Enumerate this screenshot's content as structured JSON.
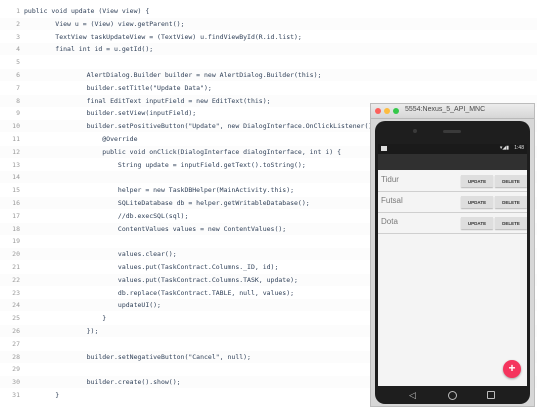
{
  "code_lines": [
    {
      "n": "1",
      "t": "public void update (View view) {"
    },
    {
      "n": "2",
      "t": "        View u = (View) view.getParent();"
    },
    {
      "n": "3",
      "t": "        TextView taskUpdateView = (TextView) u.findViewById(R.id.list);"
    },
    {
      "n": "4",
      "t": "        final int id = u.getId();"
    },
    {
      "n": "5",
      "t": ""
    },
    {
      "n": "6",
      "t": "                AlertDialog.Builder builder = new AlertDialog.Builder(this);"
    },
    {
      "n": "7",
      "t": "                builder.setTitle(\"Update Data\");"
    },
    {
      "n": "8",
      "t": "                final EditText inputField = new EditText(this);"
    },
    {
      "n": "9",
      "t": "                builder.setView(inputField);"
    },
    {
      "n": "10",
      "t": "                builder.setPositiveButton(\"Update\", new DialogInterface.OnClickListener() {"
    },
    {
      "n": "11",
      "t": "                    @Override"
    },
    {
      "n": "12",
      "t": "                    public void onClick(DialogInterface dialogInterface, int i) {"
    },
    {
      "n": "13",
      "t": "                        String update = inputField.getText().toString();"
    },
    {
      "n": "14",
      "t": ""
    },
    {
      "n": "15",
      "t": "                        helper = new TaskDBHelper(MainActivity.this);"
    },
    {
      "n": "16",
      "t": "                        SQLiteDatabase db = helper.getWritableDatabase();"
    },
    {
      "n": "17",
      "t": "                        //db.execSQL(sql);"
    },
    {
      "n": "18",
      "t": "                        ContentValues values = new ContentValues();"
    },
    {
      "n": "19",
      "t": ""
    },
    {
      "n": "20",
      "t": "                        values.clear();"
    },
    {
      "n": "21",
      "t": "                        values.put(TaskContract.Columns._ID, id);"
    },
    {
      "n": "22",
      "t": "                        values.put(TaskContract.Columns.TASK, update);"
    },
    {
      "n": "23",
      "t": "                        db.replace(TaskContract.TABLE, null, values);"
    },
    {
      "n": "24",
      "t": "                        updateUI();"
    },
    {
      "n": "25",
      "t": "                    }"
    },
    {
      "n": "26",
      "t": "                });"
    },
    {
      "n": "27",
      "t": ""
    },
    {
      "n": "28",
      "t": "                builder.setNegativeButton(\"Cancel\", null);"
    },
    {
      "n": "29",
      "t": ""
    },
    {
      "n": "30",
      "t": "                builder.create().show();"
    },
    {
      "n": "31",
      "t": "        }"
    }
  ],
  "emulator": {
    "window_title": "5554:Nexus_5_API_MNC",
    "status_time": "1:48",
    "status_icons": "▾◢▮",
    "tasks": [
      {
        "name": "Tidur",
        "update_label": "UPDATE",
        "delete_label": "DELETE"
      },
      {
        "name": "Futsal",
        "update_label": "UPDATE",
        "delete_label": "DELETE"
      },
      {
        "name": "Dota",
        "update_label": "UPDATE",
        "delete_label": "DELETE"
      }
    ],
    "fab_label": "+",
    "nav_back": "◁"
  },
  "colors": {
    "code_text": "#2e3f57",
    "line_number": "#9a9a9a",
    "fab": "#f5355e"
  }
}
